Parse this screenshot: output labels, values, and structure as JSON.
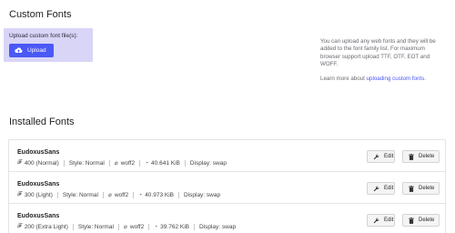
{
  "custom_fonts": {
    "title": "Custom Fonts",
    "upload_label": "Upload custom font file(s):",
    "upload_button": "Upload",
    "help_text": "You can upload any web fonts and they will be added to the font family list. For maximum browser support upload TTF, OTF, EOT and WOFF.",
    "learn_more_prefix": "Learn more about ",
    "learn_more_link": "uploading custom fonts",
    "learn_more_suffix": "."
  },
  "installed": {
    "title": "Installed Fonts",
    "edit_label": "Edit",
    "delete_label": "Delete",
    "fonts": [
      {
        "name": "EudoxusSans",
        "weight": "400 (Normal)",
        "style": "Style: Normal",
        "format": "woff2",
        "size": "40.641 KiB",
        "display": "Display: swap"
      },
      {
        "name": "EudoxusSans",
        "weight": "300 (Light)",
        "style": "Style: Normal",
        "format": "woff2",
        "size": "40.973 KiB",
        "display": "Display: swap"
      },
      {
        "name": "EudoxusSans",
        "weight": "200 (Extra Light)",
        "style": "Style: Normal",
        "format": "woff2",
        "size": "39.762 KiB",
        "display": "Display: swap"
      }
    ]
  },
  "colors": {
    "accent": "#4a58f6",
    "upload_bg": "#d9d5f7"
  },
  "icons": {
    "upload": "cloud-upload-icon",
    "edit": "wrench-icon",
    "delete": "trash-icon",
    "weight": "font-weight-icon",
    "format": "paperclip-icon",
    "size": "gauge-icon"
  }
}
